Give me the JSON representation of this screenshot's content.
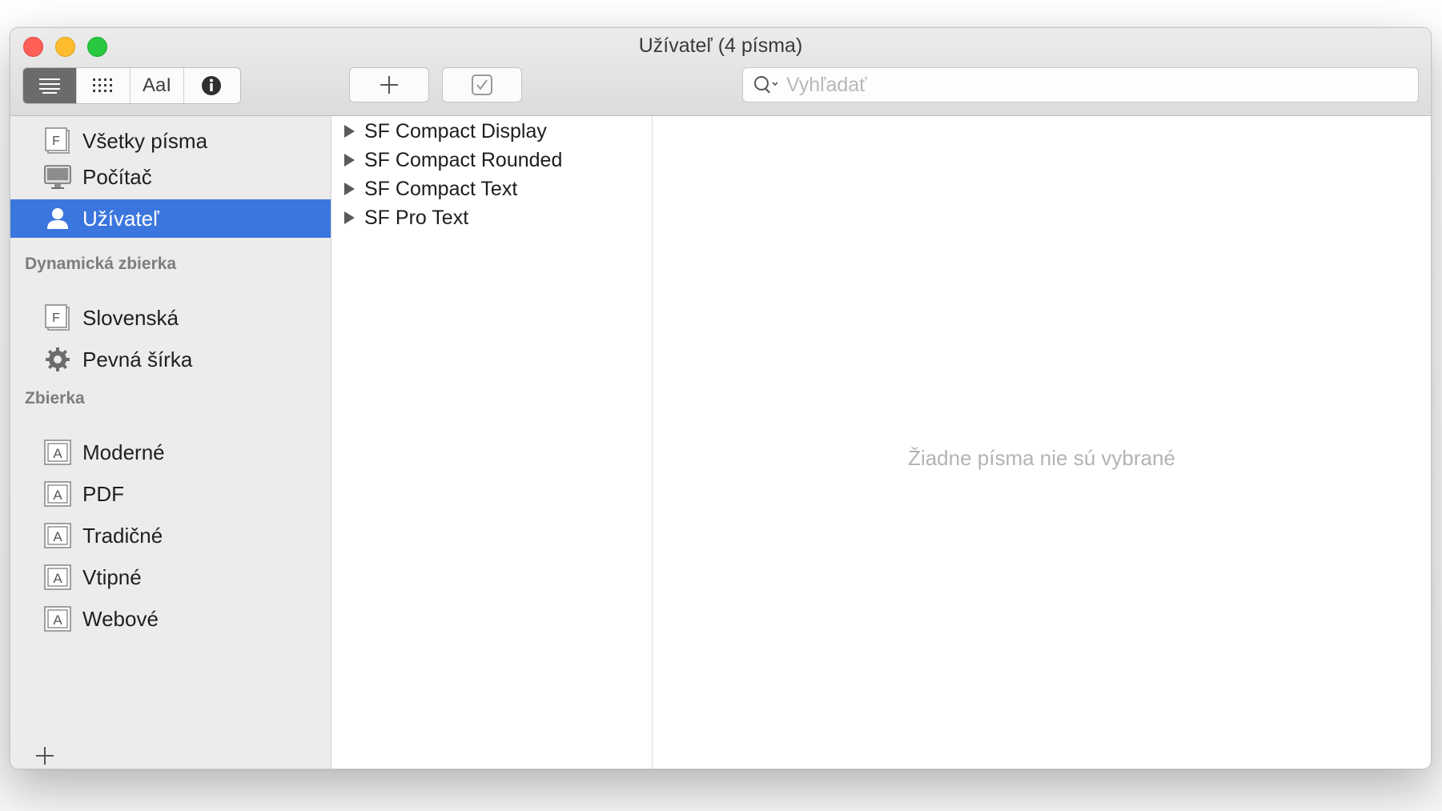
{
  "window": {
    "title": "Užívateľ (4 písma)"
  },
  "toolbar": {
    "view_modes": [
      {
        "icon": "list-lines-icon",
        "active": true
      },
      {
        "icon": "grid-dots-icon",
        "active": false
      },
      {
        "icon": "text-sample-icon",
        "label": "AaI",
        "active": false
      },
      {
        "icon": "info-icon",
        "active": false
      }
    ],
    "add_icon": "plus-icon",
    "validate_icon": "checkbox-icon",
    "search": {
      "placeholder": "Vyhľadať",
      "value": ""
    }
  },
  "sidebar": {
    "library_items": [
      {
        "label": "Všetky písma",
        "icon": "font-collection-icon",
        "selected": false
      },
      {
        "label": "Počítač",
        "icon": "computer-icon",
        "selected": false
      },
      {
        "label": "Užívateľ",
        "icon": "user-icon",
        "selected": true
      }
    ],
    "dynamic_section_title": "Dynamická zbierka",
    "dynamic_items": [
      {
        "label": "Slovenská",
        "icon": "font-collection-icon"
      },
      {
        "label": "Pevná šírka",
        "icon": "gear-icon"
      }
    ],
    "collection_section_title": "Zbierka",
    "collection_items": [
      {
        "label": "Moderné",
        "icon": "collection-a-icon"
      },
      {
        "label": "PDF",
        "icon": "collection-a-icon"
      },
      {
        "label": "Tradičné",
        "icon": "collection-a-icon"
      },
      {
        "label": "Vtipné",
        "icon": "collection-a-icon"
      },
      {
        "label": "Webové",
        "icon": "collection-a-icon"
      }
    ],
    "add_icon": "plus-icon"
  },
  "families": [
    "SF Compact Display",
    "SF Compact Rounded",
    "SF Compact Text",
    "SF Pro Text"
  ],
  "preview": {
    "empty_message": "Žiadne písma nie sú vybrané"
  },
  "colors": {
    "selection": "#3b76de",
    "sidebar_bg": "#ececec",
    "close": "#fe5f57",
    "minimize": "#febc2e",
    "maximize": "#28c840"
  }
}
